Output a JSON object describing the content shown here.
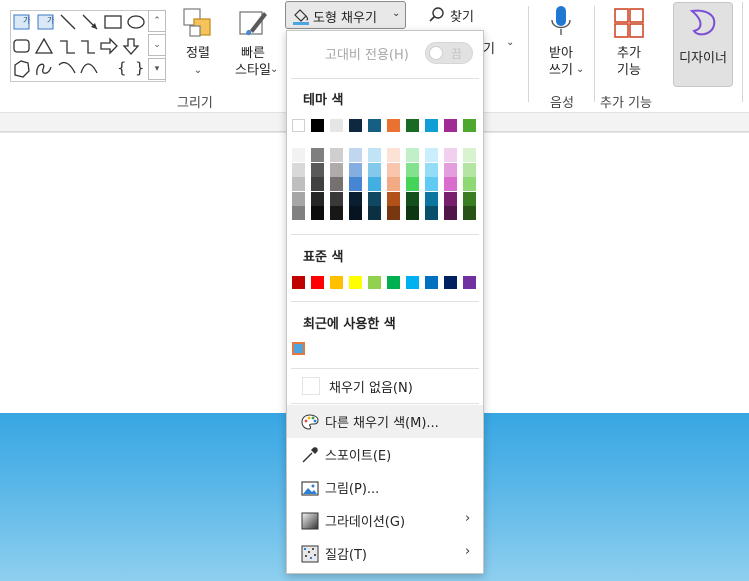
{
  "ribbon": {
    "arrange_label": "정렬",
    "quick_styles_line1": "빠른",
    "quick_styles_line2": "스타일",
    "group_drawing": "그리기",
    "shape_fill_label": "도형 채우기",
    "find_label": "찾기",
    "hidden_partial_text": "기",
    "dictate_line1": "받아",
    "dictate_line2": "쓰기",
    "group_voice": "음성",
    "addins_line1": "추가",
    "addins_line2": "기능",
    "group_addins": "추가 기능",
    "designer_label": "디자이너",
    "gallery_textbox_labels": [
      "가",
      "가"
    ],
    "gallery_brace_open": "{",
    "gallery_brace_close": "}"
  },
  "menu": {
    "high_contrast_label": "고대비 전용(H)",
    "high_contrast_state": "끔",
    "theme_colors_heading": "테마 색",
    "standard_colors_heading": "표준 색",
    "recent_colors_heading": "최근에 사용한 색",
    "no_fill": "채우기 없음(N)",
    "more_fill_colors": "다른 채우기 색(M)...",
    "eyedropper": "스포이트(E)",
    "picture": "그림(P)...",
    "gradient": "그라데이션(G)",
    "texture": "질감(T)",
    "submenu_arrow": "›"
  },
  "colors": {
    "theme_base": [
      "#ffffff",
      "#000000",
      "#e7e6e6",
      "#0e2841",
      "#156082",
      "#e97132",
      "#196b24",
      "#0f9ed5",
      "#a02b93",
      "#4ea72e"
    ],
    "theme_shades": [
      [
        "#f2f2f2",
        "#d9d9d9",
        "#bfbfbf",
        "#a6a6a6",
        "#808080"
      ],
      [
        "#7f7f7f",
        "#595959",
        "#404040",
        "#262626",
        "#0d0d0d"
      ],
      [
        "#d0cece",
        "#afabab",
        "#767171",
        "#3b3838",
        "#181717"
      ],
      [
        "#c1d6f0",
        "#84aee1",
        "#4685d2",
        "#0a1e31",
        "#061421"
      ],
      [
        "#c0e4f5",
        "#82c9ec",
        "#43aee2",
        "#104861",
        "#0b3041"
      ],
      [
        "#fbe2d5",
        "#f7c6ac",
        "#f2aa84",
        "#b35218",
        "#793710"
      ],
      [
        "#c1f0c8",
        "#83e28e",
        "#46d35a",
        "#13501b",
        "#0d3612"
      ],
      [
        "#caeefb",
        "#95dcf7",
        "#60caf3",
        "#0b769f",
        "#074f6a"
      ],
      [
        "#f2cfee",
        "#e59edd",
        "#d86dcd",
        "#78206e",
        "#501649"
      ],
      [
        "#d9f2d0",
        "#b4e5a2",
        "#8ed973",
        "#3a7d22",
        "#275317"
      ]
    ],
    "standard": [
      "#c00000",
      "#ff0000",
      "#ffc000",
      "#ffff00",
      "#92d050",
      "#00b050",
      "#00b0f0",
      "#0070c0",
      "#002060",
      "#7030a0"
    ],
    "recent": [
      "#4ba6df"
    ],
    "sky_blue": "#37a6e3"
  }
}
